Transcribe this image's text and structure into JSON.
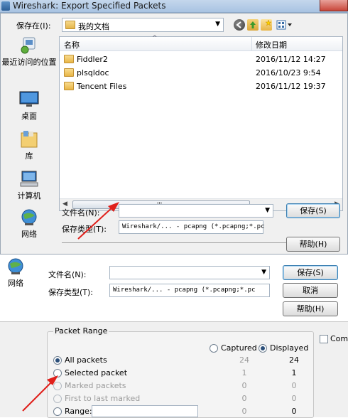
{
  "window": {
    "title": "Wireshark: Export Specified Packets"
  },
  "save_in": {
    "label": "保存在(I):",
    "value": "我的文档"
  },
  "places": [
    {
      "label": "最近访问的位置",
      "icon": "recent-places-icon"
    },
    {
      "label": "桌面",
      "icon": "desktop-icon"
    },
    {
      "label": "库",
      "icon": "libraries-icon"
    },
    {
      "label": "计算机",
      "icon": "computer-icon"
    },
    {
      "label": "网络",
      "icon": "network-icon"
    }
  ],
  "file_list": {
    "columns": {
      "name": "名称",
      "modified": "修改日期"
    },
    "rows": [
      {
        "name": "Fiddler2",
        "modified": "2016/11/12 14:27"
      },
      {
        "name": "plsqldoc",
        "modified": "2016/10/23 9:54"
      },
      {
        "name": "Tencent Files",
        "modified": "2016/11/12 19:37"
      }
    ],
    "scroll_grip": "III"
  },
  "dialog1": {
    "filename_label": "文件名(N):",
    "filename_value": "",
    "filetype_label": "保存类型(T):",
    "filetype_value": "Wireshark/... - pcapng (*.pcapng;*.pc",
    "save_button": "保存(S)",
    "help_button": "帮助(H)"
  },
  "dialog2": {
    "network_label": "网络",
    "filename_label": "文件名(N):",
    "filename_value": "",
    "filetype_label": "保存类型(T):",
    "filetype_value": "Wireshark/... - pcapng (*.pcapng;*.pc",
    "save_button": "保存(S)",
    "cancel_button": "取消",
    "help_button": "帮助(H)"
  },
  "packet_range": {
    "title": "Packet Range",
    "captured_label": "Captured",
    "displayed_label": "Displayed",
    "options": [
      {
        "label": "All packets",
        "captured": "24",
        "displayed": "24",
        "selected": true,
        "enabled": true
      },
      {
        "label": "Selected packet",
        "captured": "1",
        "displayed": "1",
        "selected": false,
        "enabled": true
      },
      {
        "label": "Marked packets",
        "captured": "0",
        "displayed": "0",
        "selected": false,
        "enabled": false
      },
      {
        "label": "First to last marked",
        "captured": "0",
        "displayed": "0",
        "selected": false,
        "enabled": false
      },
      {
        "label": "Range:",
        "captured": "0",
        "displayed": "0",
        "selected": false,
        "enabled": true
      }
    ],
    "range_value": "",
    "compress_label": "Comp"
  },
  "colors": {
    "annotation_arrow": "#e0201b",
    "dialog_bg": "#f0f0f0",
    "selection_blue": "#2b4f7a"
  }
}
